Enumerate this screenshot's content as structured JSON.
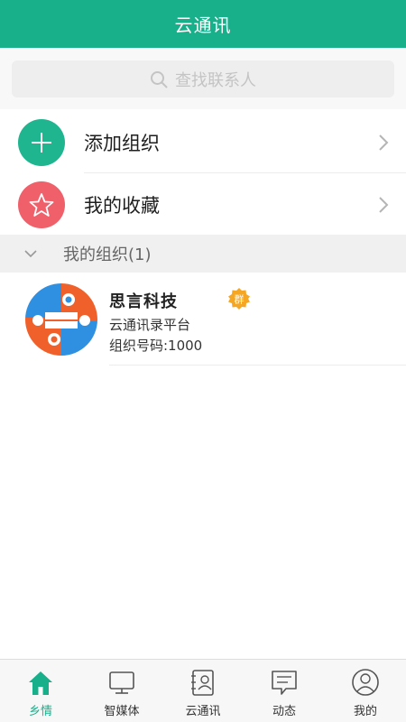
{
  "header": {
    "title": "云通讯"
  },
  "search": {
    "placeholder": "查找联系人"
  },
  "menu": [
    {
      "label": "添加组织",
      "icon": "plus-icon",
      "color": "#1fb58f"
    },
    {
      "label": "我的收藏",
      "icon": "star-icon",
      "color": "#f0606a"
    }
  ],
  "group": {
    "title": "我的组织(1)",
    "orgs": [
      {
        "name": "思言科技",
        "badge": "群",
        "desc": "云通讯录平台",
        "number": "组织号码:1000"
      }
    ]
  },
  "tabs": [
    {
      "label": "乡情",
      "icon": "home-icon",
      "active": true
    },
    {
      "label": "智媒体",
      "icon": "tv-icon",
      "active": false
    },
    {
      "label": "云通讯",
      "icon": "contacts-icon",
      "active": false
    },
    {
      "label": "动态",
      "icon": "message-icon",
      "active": false
    },
    {
      "label": "我的",
      "icon": "user-icon",
      "active": false
    }
  ],
  "colors": {
    "primary": "#17b08a",
    "add": "#1fb58f",
    "favorite": "#f0606a",
    "badge": "#f5a623"
  }
}
